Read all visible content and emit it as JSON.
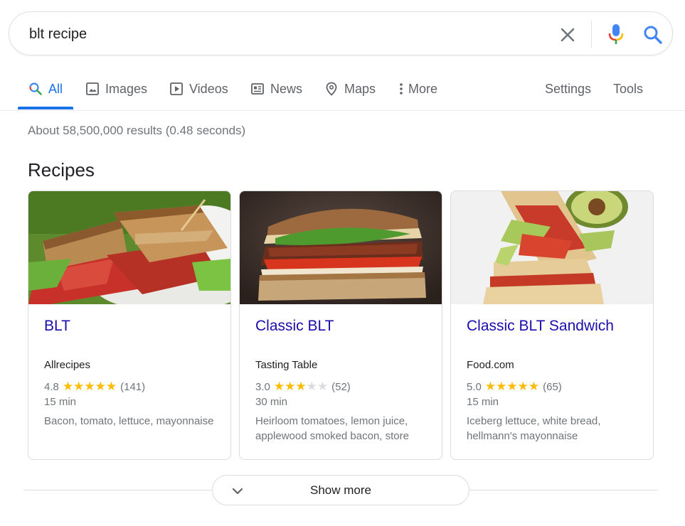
{
  "search": {
    "query": "blt recipe"
  },
  "tabs": [
    {
      "label": "All",
      "icon": "search-icon"
    },
    {
      "label": "Images",
      "icon": "image-icon"
    },
    {
      "label": "Videos",
      "icon": "play-icon"
    },
    {
      "label": "News",
      "icon": "newspaper-icon"
    },
    {
      "label": "Maps",
      "icon": "map-pin-icon"
    },
    {
      "label": "More",
      "icon": "more-vert-icon"
    }
  ],
  "tools": {
    "settings": "Settings",
    "tools": "Tools"
  },
  "result_stats": "About 58,500,000 results (0.48 seconds)",
  "section_title": "Recipes",
  "recipes": [
    {
      "title": "BLT",
      "source": "Allrecipes",
      "rating": "4.8",
      "rating_value": 4.8,
      "reviews": "(141)",
      "time": "15 min",
      "ingredients": "Bacon, tomato, lettuce, mayonnaise"
    },
    {
      "title": "Classic BLT",
      "source": "Tasting Table",
      "rating": "3.0",
      "rating_value": 3.0,
      "reviews": "(52)",
      "time": "30 min",
      "ingredients": "Heirloom tomatoes, lemon juice, applewood smoked bacon, store"
    },
    {
      "title": "Classic BLT Sandwich",
      "source": "Food.com",
      "rating": "5.0",
      "rating_value": 5.0,
      "reviews": "(65)",
      "time": "15 min",
      "ingredients": "Iceberg lettuce, white bread, hellmann's mayonnaise"
    }
  ],
  "show_more": "Show more",
  "colors": {
    "accent": "#1a73e8",
    "link": "#1a0dab",
    "star": "#fbbc04",
    "muted": "#70757a"
  }
}
